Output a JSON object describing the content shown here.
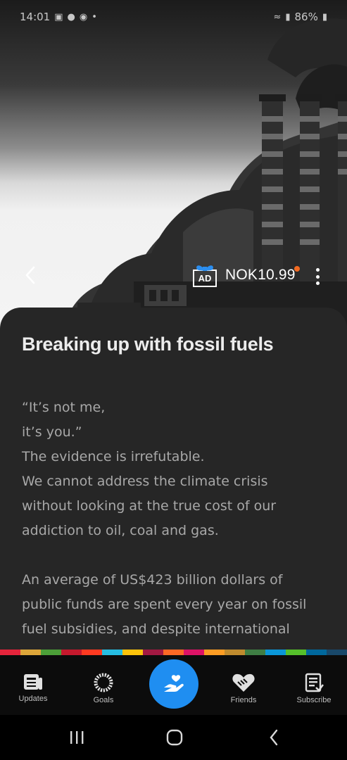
{
  "status_bar": {
    "time": "14:01",
    "battery": "86%"
  },
  "header": {
    "ad_label": "AD",
    "price": "NOK10.99"
  },
  "article": {
    "title": "Breaking up with fossil fuels",
    "lines": [
      "“It’s not me,",
      "it’s you.”",
      "The evidence is irrefutable.",
      "We cannot address the climate crisis",
      "without looking at the true cost of our",
      "addiction to oil, coal and gas."
    ],
    "paragraph2": [
      "An average of US$423 billion dollars of",
      "public funds are spent every year on fossil",
      "fuel subsidies, and despite international"
    ]
  },
  "sdg_colors": [
    "#e5243b",
    "#dda63a",
    "#4c9f38",
    "#c5192d",
    "#ff3a21",
    "#26bde2",
    "#fcc30b",
    "#a21942",
    "#fd6925",
    "#dd1367",
    "#fd9d24",
    "#bf8b2e",
    "#3f7e44",
    "#0a97d9",
    "#56c02b",
    "#00689d",
    "#19486a"
  ],
  "nav": {
    "updates": "Updates",
    "goals": "Goals",
    "friends": "Friends",
    "subscribe": "Subscribe"
  },
  "icons": {
    "back": "chevron-left-icon",
    "ad": "gift-ad-icon",
    "menu": "more-vertical-icon",
    "center": "hand-heart-icon"
  },
  "accent_color": "#1f8ef1"
}
